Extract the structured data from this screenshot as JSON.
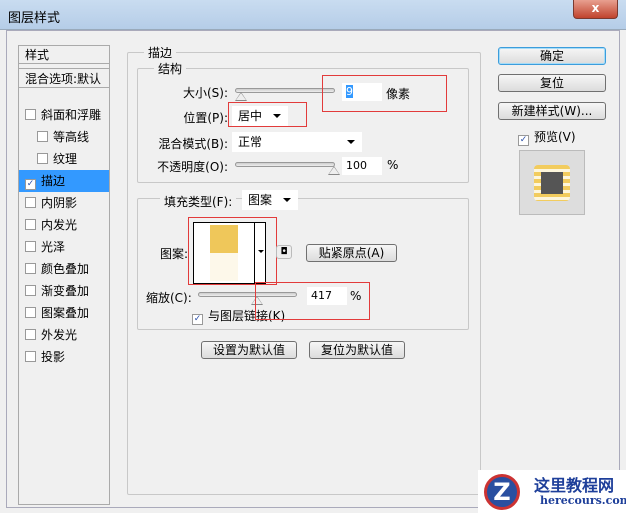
{
  "window": {
    "title": "图层样式",
    "close_label": "x"
  },
  "sidebar": {
    "header": "样式",
    "blend_options": "混合选项:默认",
    "items": [
      {
        "label": "斜面和浮雕",
        "checked": false,
        "sub": false
      },
      {
        "label": "等高线",
        "checked": false,
        "sub": true
      },
      {
        "label": "纹理",
        "checked": false,
        "sub": true
      },
      {
        "label": "描边",
        "checked": true,
        "sub": false,
        "selected": true
      },
      {
        "label": "内阴影",
        "checked": false,
        "sub": false
      },
      {
        "label": "内发光",
        "checked": false,
        "sub": false
      },
      {
        "label": "光泽",
        "checked": false,
        "sub": false
      },
      {
        "label": "颜色叠加",
        "checked": false,
        "sub": false
      },
      {
        "label": "渐变叠加",
        "checked": false,
        "sub": false
      },
      {
        "label": "图案叠加",
        "checked": false,
        "sub": false
      },
      {
        "label": "外发光",
        "checked": false,
        "sub": false
      },
      {
        "label": "投影",
        "checked": false,
        "sub": false
      }
    ]
  },
  "stroke": {
    "title": "描边",
    "structure": {
      "title": "结构",
      "size_label": "大小(S):",
      "size_value": "9",
      "size_unit": "像素",
      "size_fraction": 0.05,
      "position_label": "位置(P):",
      "position_value": "居中",
      "blend_label": "混合模式(B):",
      "blend_value": "正常",
      "opacity_label": "不透明度(O):",
      "opacity_value": "100",
      "opacity_unit": "%",
      "opacity_fraction": 1.0
    },
    "fill": {
      "type_label": "填充类型(F):",
      "type_value": "图案",
      "pattern_label": "图案:",
      "snap_button": "贴紧原点(A)",
      "scale_label": "缩放(C):",
      "scale_value": "417",
      "scale_unit": "%",
      "scale_fraction": 0.6,
      "link_label": "与图层链接(K)",
      "link_checked": true,
      "pattern_colors": [
        "#efc75a",
        "#fdf8ea"
      ]
    },
    "set_default": "设置为默认值",
    "reset_default": "复位为默认值"
  },
  "actions": {
    "ok": "确定",
    "reset": "复位",
    "new_style": "新建样式(W)...",
    "preview_label": "预览(V)",
    "preview_checked": true
  },
  "watermark": {
    "text": "这里教程网",
    "url": "herecours.com"
  }
}
